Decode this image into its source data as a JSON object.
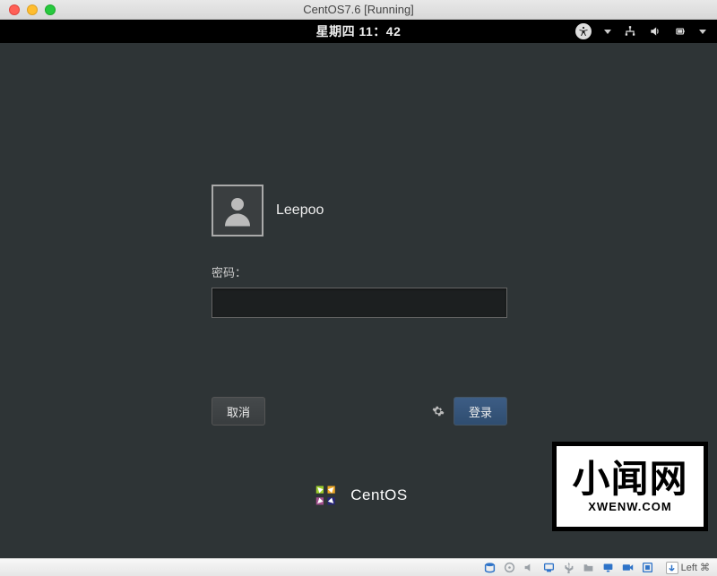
{
  "window": {
    "title": "CentOS7.6 [Running]"
  },
  "topbar": {
    "clock": "星期四 11：42"
  },
  "login": {
    "username": "Leepoo",
    "password_label": "密码：",
    "password_value": "",
    "cancel_label": "取消",
    "login_label": "登录"
  },
  "branding": {
    "os_name": "CentOS"
  },
  "watermark": {
    "cn": "小闻网",
    "en": "XWENW.COM"
  },
  "statusbar": {
    "host_key": "Left ⌘"
  }
}
